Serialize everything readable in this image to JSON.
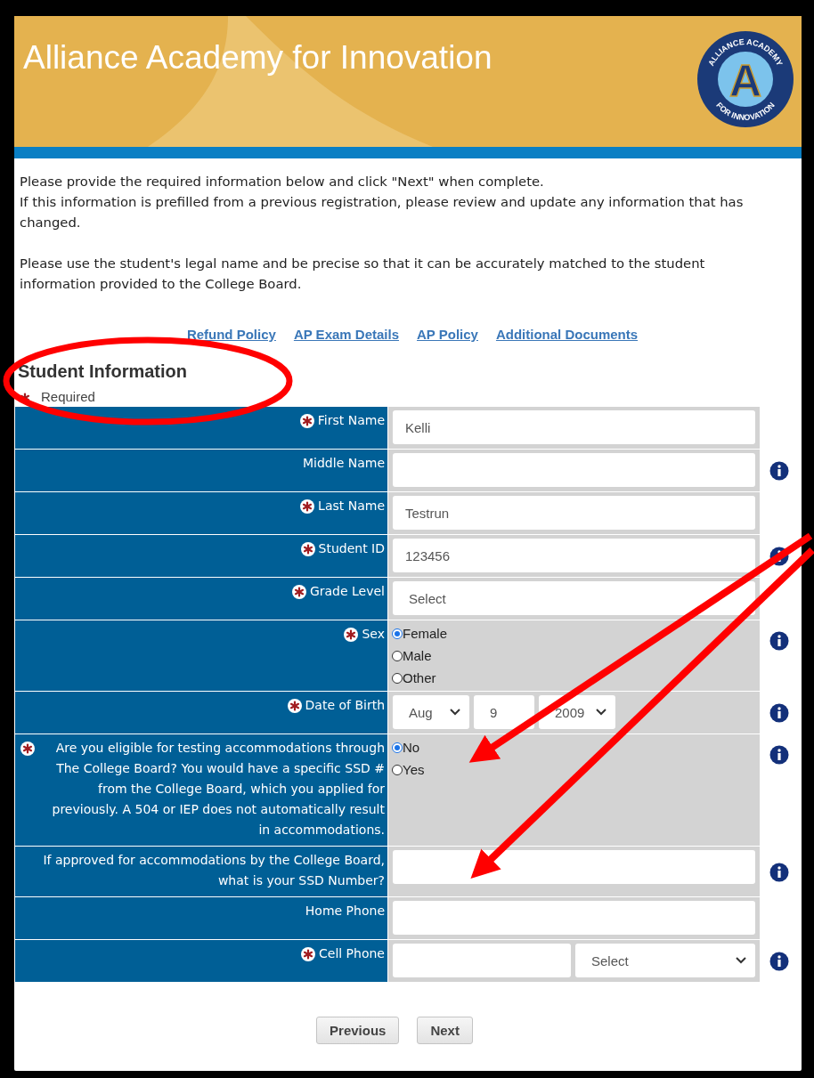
{
  "header": {
    "title": "Alliance Academy for Innovation",
    "logo": {
      "top_text": "ALLIANCE ACADEMY",
      "letter": "A",
      "bottom_text": "FOR INNOVATION"
    }
  },
  "intro": [
    "Please provide the required information below and click \"Next\" when complete.",
    "If this information is prefilled from a previous registration, please review and update any information that has changed.",
    "Please use the student's legal name and be precise so that it can be accurately matched to the student information provided to the College Board."
  ],
  "links": [
    "Refund Policy",
    "AP Exam Details",
    "AP Policy",
    "Additional Documents"
  ],
  "section": {
    "title": "Student Information",
    "required_note": "Required"
  },
  "rows": [
    {
      "kind": "text",
      "label": "First Name",
      "required": true,
      "info": false,
      "value": "Kelli"
    },
    {
      "kind": "text",
      "label": "Middle Name",
      "required": false,
      "info": true
    },
    {
      "kind": "text",
      "label": "Last Name",
      "required": true,
      "info": false,
      "value": "Testrun"
    },
    {
      "kind": "text",
      "label": "Student ID",
      "required": true,
      "info": true,
      "value": "123456"
    },
    {
      "kind": "select",
      "label": "Grade Level",
      "required": true,
      "info": false,
      "value": "Select"
    },
    {
      "kind": "radio",
      "label": "Sex",
      "required": true,
      "info": true,
      "options": [
        {
          "label": "Female",
          "selected": true
        },
        {
          "label": "Male",
          "selected": false
        },
        {
          "label": "Other",
          "selected": false
        }
      ]
    },
    {
      "kind": "date",
      "label": "Date of Birth",
      "required": true,
      "info": true,
      "parts": [
        "Aug",
        "9",
        "2009"
      ]
    },
    {
      "kind": "radio",
      "label": "Are you eligible for testing accommodations through The College Board? You would have a specific SSD # from the College Board, which you applied for previously. A 504 or IEP does not automatically result in accommodations.",
      "required": true,
      "info": true,
      "options": [
        {
          "label": "No",
          "selected": true
        },
        {
          "label": "Yes",
          "selected": false
        }
      ]
    },
    {
      "kind": "text",
      "label": "If approved for accommodations by the College Board, what is your SSD Number?",
      "required": false,
      "info": true
    },
    {
      "kind": "text",
      "label": "Home Phone",
      "required": false,
      "info": false
    },
    {
      "kind": "phone",
      "label": "Cell Phone",
      "required": true,
      "info": true,
      "value": "Select"
    }
  ],
  "buttons": [
    "Previous",
    "Next"
  ]
}
